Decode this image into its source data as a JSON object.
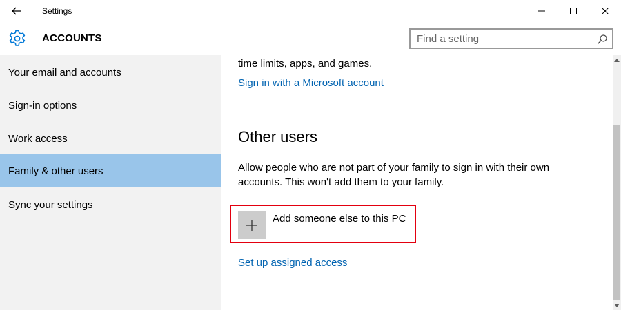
{
  "window": {
    "title": "Settings",
    "icons": {
      "back": "back-arrow-icon",
      "minimize": "minimize-icon",
      "maximize": "maximize-icon",
      "close": "close-icon"
    }
  },
  "header": {
    "title": "ACCOUNTS",
    "icon": "gear-icon",
    "search_placeholder": "Find a setting",
    "search_icon": "search-icon"
  },
  "sidebar": {
    "items": [
      {
        "label": "Your email and accounts"
      },
      {
        "label": "Sign-in options"
      },
      {
        "label": "Work access"
      },
      {
        "label": "Family & other users",
        "active": true
      },
      {
        "label": "Sync your settings"
      }
    ]
  },
  "content": {
    "family_text_cut": "time limits, apps, and games.",
    "signin_link": "Sign in with a Microsoft account",
    "other_users_title": "Other users",
    "other_users_desc": "Allow people who are not part of your family to sign in with their own accounts. This won't add them to your family.",
    "add_someone_label": "Add someone else to this PC",
    "assigned_access_link": "Set up assigned access"
  },
  "colors": {
    "accent": "#0078d7",
    "link": "#0063b1",
    "sidebar_bg": "#f2f2f2",
    "sidebar_active": "#99c5ea",
    "highlight_border": "#e3000f"
  }
}
